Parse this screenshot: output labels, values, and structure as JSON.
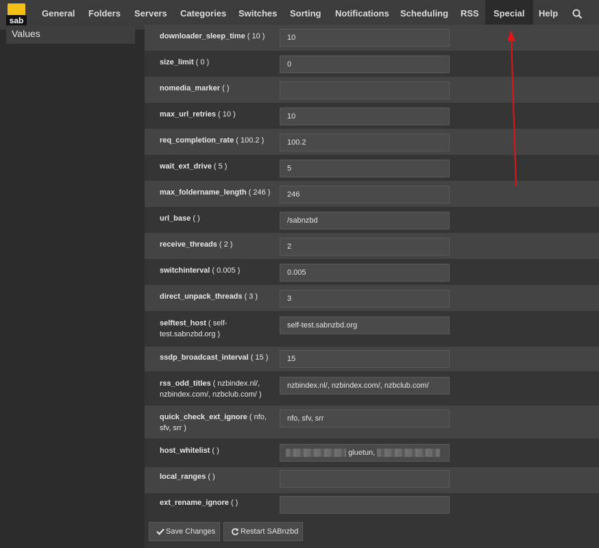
{
  "nav": {
    "logo_text": "sab",
    "items": [
      "General",
      "Folders",
      "Servers",
      "Categories",
      "Switches",
      "Sorting",
      "Notifications",
      "Scheduling",
      "RSS",
      "Special",
      "Help"
    ],
    "active": "Special",
    "search_icon": "search-icon"
  },
  "sidebar": {
    "item": "Values"
  },
  "settings": [
    {
      "name": "downloader_sleep_time",
      "default": "( 10 )",
      "value": "10"
    },
    {
      "name": "size_limit",
      "default": "( 0 )",
      "value": "0"
    },
    {
      "name": "nomedia_marker",
      "default": "(  )",
      "value": ""
    },
    {
      "name": "max_url_retries",
      "default": "( 10 )",
      "value": "10"
    },
    {
      "name": "req_completion_rate",
      "default": "( 100.2 )",
      "value": "100.2"
    },
    {
      "name": "wait_ext_drive",
      "default": "( 5 )",
      "value": "5"
    },
    {
      "name": "max_foldername_length",
      "default": "( 246 )",
      "value": "246"
    },
    {
      "name": "url_base",
      "default": "(  )",
      "value": "/sabnzbd"
    },
    {
      "name": "receive_threads",
      "default": "( 2 )",
      "value": "2"
    },
    {
      "name": "switchinterval",
      "default": "( 0.005 )",
      "value": "0.005"
    },
    {
      "name": "direct_unpack_threads",
      "default": "( 3 )",
      "value": "3"
    },
    {
      "name": "selftest_host",
      "default_open": "( ",
      "default_value": "self-test.sabnzbd.org",
      "default_close": " )",
      "value": "self-test.sabnzbd.org"
    },
    {
      "name": "ssdp_broadcast_interval",
      "default": "( 15 )",
      "value": "15"
    },
    {
      "name": "rss_odd_titles",
      "default_open": "( ",
      "default_value": "nzbindex.nl/, nzbindex.com/, nzbclub.com/",
      "default_close": " )",
      "value": "nzbindex.nl/, nzbindex.com/, nzbclub.com/"
    },
    {
      "name": "quick_check_ext_ignore",
      "default_open": "( ",
      "default_value": "nfo, sfv, srr",
      "default_close": " )",
      "value": "nfo, sfv, srr"
    },
    {
      "name": "host_whitelist",
      "default": "(  )",
      "value_visible": "gluetun,"
    },
    {
      "name": "local_ranges",
      "default": "(  )",
      "value": ""
    },
    {
      "name": "ext_rename_ignore",
      "default": "(  )",
      "value": ""
    }
  ],
  "buttons": {
    "save": "Save Changes",
    "restart": "Restart SABnzbd"
  },
  "colors": {
    "logo_yellow": "#f4c015",
    "annotation_arrow": "#e0161b"
  }
}
